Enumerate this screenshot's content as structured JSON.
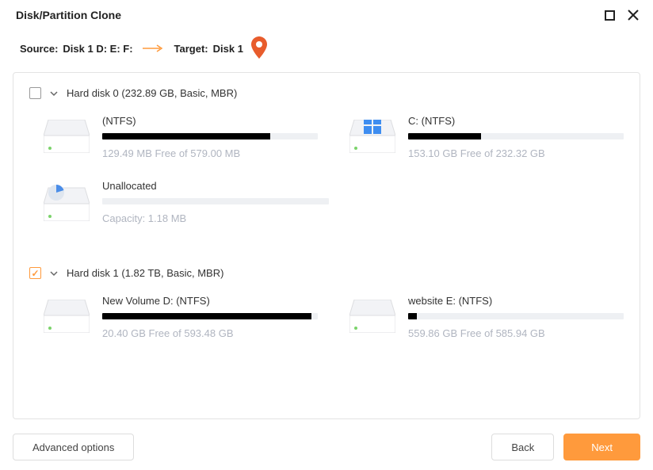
{
  "window": {
    "title": "Disk/Partition Clone"
  },
  "header": {
    "source_label": "Source:",
    "source_value": "Disk 1 D: E: F:",
    "target_label": "Target:",
    "target_value": "Disk 1"
  },
  "disks": [
    {
      "checked": false,
      "title": "Hard disk 0 (232.89 GB, Basic, MBR)",
      "partitions": [
        {
          "icon": "drive",
          "name": "(NTFS)",
          "usage_text": "129.49 MB Free of 579.00 MB",
          "fill_pct": 78
        },
        {
          "icon": "windows-drive",
          "name": "C: (NTFS)",
          "usage_text": "153.10 GB Free of 232.32 GB",
          "fill_pct": 34
        },
        {
          "icon": "pie-drive",
          "name": "Unallocated",
          "usage_text": "Capacity: 1.18 MB",
          "fill_pct": 0
        }
      ]
    },
    {
      "checked": true,
      "title": "Hard disk 1 (1.82 TB, Basic, MBR)",
      "partitions": [
        {
          "icon": "drive",
          "name": "New Volume D: (NTFS)",
          "usage_text": "20.40 GB Free of 593.48 GB",
          "fill_pct": 97
        },
        {
          "icon": "drive",
          "name": "website E: (NTFS)",
          "usage_text": "559.86 GB Free of 585.94 GB",
          "fill_pct": 4
        }
      ]
    }
  ],
  "footer": {
    "advanced": "Advanced options",
    "back": "Back",
    "next": "Next"
  }
}
